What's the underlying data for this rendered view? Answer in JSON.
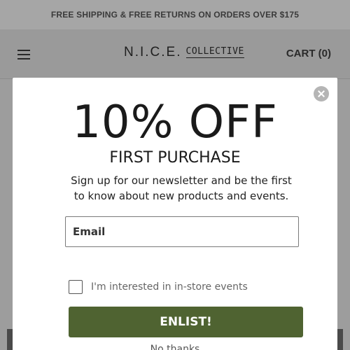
{
  "announcement": {
    "text": "FREE SHIPPING & FREE RETURNS ON ORDERS OVER $175"
  },
  "header": {
    "menu_icon": "hamburger-menu-icon",
    "logo_main": "N.I.C.E.",
    "logo_sub": "COLLECTIVE",
    "cart_label": "CART (0)"
  },
  "modal": {
    "close_icon": "close-icon",
    "headline": "10% OFF",
    "subheadline": "FIRST PURCHASE",
    "body_line1": "Sign up for our newsletter and be the first",
    "body_line2": "to know about new products and events.",
    "email_placeholder": "Email",
    "email_value": "",
    "consent_label": "I'm interested in in-store events",
    "consent_checked": false,
    "submit_label": "ENLIST!",
    "dismiss_label": "No thanks",
    "submit_color": "#4f6331"
  }
}
